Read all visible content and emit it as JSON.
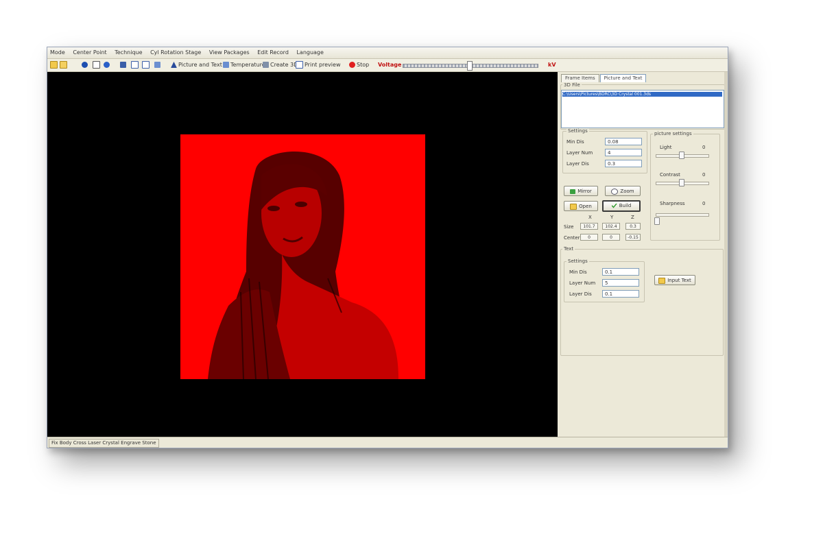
{
  "menu": [
    "Mode",
    "Center Point",
    "Technique",
    "Cyl Rotation Stage",
    "View Packages",
    "Edit Record",
    "Language"
  ],
  "toolbar": {
    "picture_and_text": "Picture and Text",
    "temperature": "Temperature",
    "create_3d": "Create 3D",
    "print_preview": "Print preview",
    "stop": "Stop",
    "voltage": "Voltage",
    "kv": "kV"
  },
  "tabs": [
    "Frame Items",
    "Picture and Text"
  ],
  "file_group": {
    "label": "3D File",
    "selected_file": "C:\\Users\\Pictures\\BDRC\\3D Crystal 001.3ds"
  },
  "picture_settings_group": {
    "label": "Settings",
    "rows": [
      {
        "label": "Min Dis",
        "value": "0.08"
      },
      {
        "label": "Layer Num",
        "value": "4"
      },
      {
        "label": "Layer Dis",
        "value": "0.3"
      }
    ]
  },
  "image_settings": {
    "label": "picture settings",
    "sliders": [
      {
        "label": "Light",
        "value": "0"
      },
      {
        "label": "Contrast",
        "value": "0"
      },
      {
        "label": "Sharpness",
        "value": "0"
      }
    ]
  },
  "buttons": {
    "mirror": "Mirror",
    "zoom": "Zoom",
    "open": "Open",
    "build": "Build"
  },
  "xyz": {
    "headers": [
      "X",
      "Y",
      "Z"
    ],
    "size_label": "Size",
    "size_values": [
      "101.7",
      "102.4",
      "0.3"
    ],
    "center_label": "Center",
    "center_values": [
      "0",
      "0",
      "-0.15"
    ]
  },
  "text_group": {
    "label": "Text",
    "settings_label": "Settings",
    "rows": [
      {
        "label": "Min Dis",
        "value": "0.1"
      },
      {
        "label": "Layer Num",
        "value": "5"
      },
      {
        "label": "Layer Dis",
        "value": "0.1"
      }
    ],
    "input_text_button": "Input Text"
  },
  "statusbar": {
    "text": "Fix Body Cross Laser Crystal Engrave Stone"
  },
  "colors": {
    "photo_tint": "#ff0000",
    "canvas": "#000000",
    "panel": "#ece9d8",
    "selection": "#316ac5"
  }
}
